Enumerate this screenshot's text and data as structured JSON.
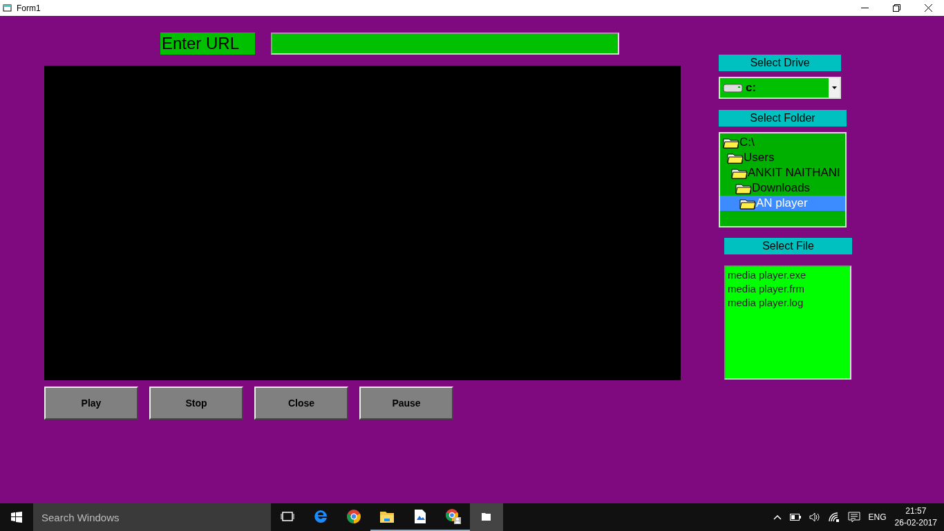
{
  "window": {
    "title": "Form1"
  },
  "url": {
    "label": "Enter URL"
  },
  "buttons": [
    "Play",
    "Stop",
    "Close",
    "Pause"
  ],
  "drive": {
    "label": "Select Drive",
    "value": "c:"
  },
  "folder": {
    "label": "Select Folder",
    "tree": [
      {
        "label": "C:\\",
        "selected": false,
        "children": [
          {
            "label": "Users",
            "selected": false,
            "children": [
              {
                "label": "ANKIT NAITHANI",
                "selected": false,
                "children": [
                  {
                    "label": "Downloads",
                    "selected": false,
                    "children": [
                      {
                        "label": "AN player",
                        "selected": true
                      }
                    ]
                  }
                ]
              }
            ]
          }
        ]
      }
    ]
  },
  "file": {
    "label": "Select File",
    "items": [
      "media player.exe",
      "media player.frm",
      "media player.log"
    ]
  },
  "taskbar": {
    "search": {
      "placeholder": "Search Windows"
    },
    "apps": [
      {
        "kind": "taskview",
        "selected": false
      },
      {
        "kind": "edge",
        "selected": false
      },
      {
        "kind": "chrome",
        "selected": false
      },
      {
        "kind": "explorer",
        "selected": false
      },
      {
        "kind": "photos",
        "selected": false
      },
      {
        "kind": "chromeuser",
        "selected": false
      },
      {
        "kind": "app",
        "selected": true
      }
    ],
    "language": "ENG",
    "time": "21:57",
    "date": "26-02-2017"
  }
}
